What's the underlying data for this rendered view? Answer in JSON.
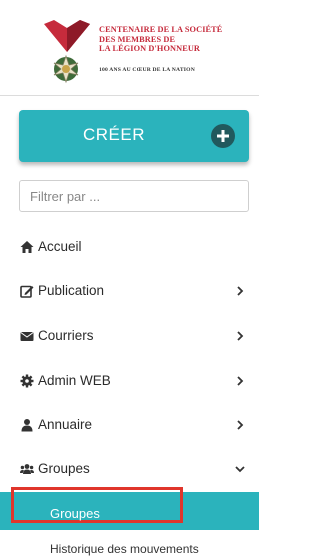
{
  "logo": {
    "title_lines": [
      "CENTENAIRE DE LA SOCIÉTÉ",
      "DES MEMBRES DE",
      "LA LÉGION D'HONNEUR"
    ],
    "subtitle": "100 ANS AU CŒUR DE LA NATION",
    "heart_color": "#c62b3c"
  },
  "create_button": {
    "label": "CRÉER",
    "icon": "plus-circle-icon",
    "color": "#2bb3bc"
  },
  "filter": {
    "placeholder": "Filtrer par ...",
    "value": ""
  },
  "nav": {
    "items": [
      {
        "label": "Accueil",
        "icon": "home-icon",
        "has_chevron": false
      },
      {
        "label": "Publication",
        "icon": "edit-icon",
        "has_chevron": true
      },
      {
        "label": "Courriers",
        "icon": "envelope-icon",
        "has_chevron": true
      },
      {
        "label": "Admin WEB",
        "icon": "gear-icon",
        "has_chevron": true
      },
      {
        "label": "Annuaire",
        "icon": "user-icon",
        "has_chevron": true
      },
      {
        "label": "Groupes",
        "icon": "users-icon",
        "has_chevron": true,
        "expanded": true
      }
    ],
    "submenu": [
      {
        "label": "Groupes",
        "active": true
      },
      {
        "label": "Historique des mouvements",
        "active": false
      }
    ]
  },
  "colors": {
    "accent": "#2bb3bc",
    "highlight_border": "#e0352b"
  }
}
